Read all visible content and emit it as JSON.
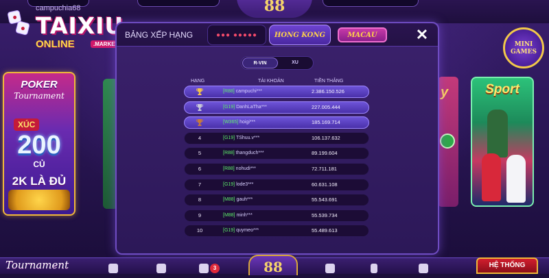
{
  "brand": {
    "name": "TAIXIU",
    "subtitle": "ONLINE",
    "badge": ".MARKETS"
  },
  "topbar": {
    "username": "campuchia68",
    "logo": "88"
  },
  "side_left": {
    "title": "POKER",
    "subtitle": "Tournament",
    "xuc": "XÚC",
    "amount": "200",
    "unit": "CỦ",
    "promo": "2K LÀ ĐỦ"
  },
  "side_right": {
    "sport_title": "Sport",
    "mini_games": "MINI GAMES",
    "partial_label": "y"
  },
  "modal": {
    "title": "BẢNG XẾP HẠNG",
    "tabs": [
      "●●● ●●●●●",
      "HONG KONG",
      "MACAU"
    ],
    "active_tab": "HONG KONG",
    "close_icon": "close-icon",
    "toggle": [
      "R-VIN",
      "XU"
    ],
    "toggle_active": "R-VIN",
    "columns": [
      "HẠNG",
      "TÀI KHOẢN",
      "TIỀN THẮNG"
    ],
    "rows": [
      {
        "rank": "",
        "tag": "[R88]",
        "name": " campuchi***",
        "amount": "2.386.150.526",
        "medal": "gold"
      },
      {
        "rank": "",
        "tag": "[G19]",
        "name": " DanhLaTha***",
        "amount": "227.005.444",
        "medal": "silver"
      },
      {
        "rank": "",
        "tag": "[W365]",
        "name": " hoigi***",
        "amount": "185.169.714",
        "medal": "bronze"
      },
      {
        "rank": "4",
        "tag": "[G19]",
        "name": " TShuu.v***",
        "amount": "106.137.632",
        "medal": ""
      },
      {
        "rank": "5",
        "tag": "[R88]",
        "name": " thangduch***",
        "amount": "89.199.604",
        "medal": ""
      },
      {
        "rank": "6",
        "tag": "[R88]",
        "name": " nohudi***",
        "amount": "72.711.181",
        "medal": ""
      },
      {
        "rank": "7",
        "tag": "[G19]",
        "name": " lode3***",
        "amount": "60.631.108",
        "medal": ""
      },
      {
        "rank": "8",
        "tag": "[M88]",
        "name": " gauh***",
        "amount": "55.543.691",
        "medal": ""
      },
      {
        "rank": "9",
        "tag": "[M88]",
        "name": " minh***",
        "amount": "55.539.734",
        "medal": ""
      },
      {
        "rank": "10",
        "tag": "[G19]",
        "name": " quymeo***",
        "amount": "55.489.613",
        "medal": ""
      }
    ]
  },
  "bottombar": {
    "tournament": "Tournament",
    "logo": "88",
    "mail_badge": "3",
    "system_label": "HỆ THỐNG"
  },
  "colors": {
    "accent_gold": "#f6d36b",
    "panel": "#2c1858",
    "tag_green": "#5ef06a"
  }
}
